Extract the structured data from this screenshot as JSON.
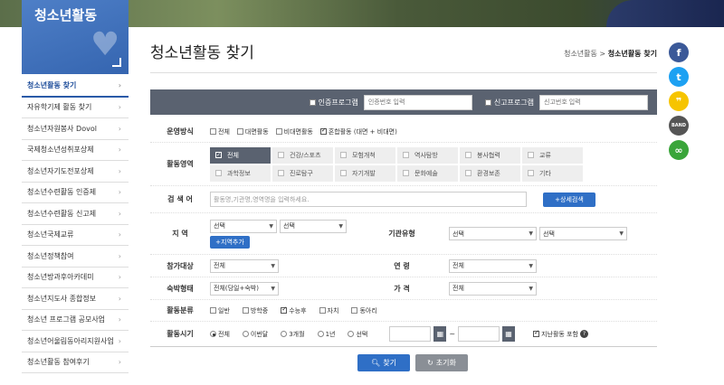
{
  "sidebar": {
    "title": "청소년활동",
    "items": [
      {
        "label": "청소년활동 찾기",
        "active": true
      },
      {
        "label": "자유학기제 활동 찾기"
      },
      {
        "label": "청소년자원봉사 Dovol"
      },
      {
        "label": "국제청소년성취포상제"
      },
      {
        "label": "청소년자기도전포상제"
      },
      {
        "label": "청소년수련활동 인증제"
      },
      {
        "label": "청소년수련활동 신고제"
      },
      {
        "label": "청소년국제교류"
      },
      {
        "label": "청소년정책참여"
      },
      {
        "label": "청소년방과후아카데미"
      },
      {
        "label": "청소년지도사 종합정보"
      },
      {
        "label": "청소년 프로그램 공모사업"
      },
      {
        "label": "청소년어울림동아리지원사업"
      },
      {
        "label": "청소년활동 참여후기"
      }
    ]
  },
  "page": {
    "title": "청소년활동 찾기",
    "breadcrumb_parent": "청소년활동",
    "breadcrumb_sep": " > ",
    "breadcrumb_current": "청소년활동 찾기"
  },
  "social": [
    {
      "icon": "facebook-icon",
      "glyph": "f",
      "color": "#3b5998"
    },
    {
      "icon": "twitter-icon",
      "glyph": "t",
      "color": "#1da1f2"
    },
    {
      "icon": "kakaostory-icon",
      "glyph": "❞",
      "color": "#f6c400"
    },
    {
      "icon": "band-icon",
      "glyph": "BAND",
      "color": "#555"
    },
    {
      "icon": "link-icon",
      "glyph": "∞",
      "color": "#3aa53a"
    }
  ],
  "topsearch": {
    "cert_label": "인증프로그램",
    "cert_placeholder": "인증번호 입력",
    "report_label": "신고프로그램",
    "report_placeholder": "신고번호 입력"
  },
  "form": {
    "operation": {
      "label": "운영방식",
      "options": [
        {
          "label": "전체",
          "checked": false
        },
        {
          "label": "대면활동",
          "checked": false
        },
        {
          "label": "비대면활동",
          "checked": false
        },
        {
          "label": "혼합활동 (대면 + 비대면)",
          "checked": true
        }
      ]
    },
    "area": {
      "label": "활동영역",
      "options": [
        "전체",
        "건강/스포츠",
        "모험개척",
        "역사탐방",
        "봉사협력",
        "교류",
        "과학정보",
        "진로탐구",
        "자기개발",
        "문화예술",
        "환경보존",
        "기타"
      ]
    },
    "keyword": {
      "label": "검 색 어",
      "placeholder": "활동명,기관명,영역명을 입력하세요.",
      "detail_button": "+상세검색"
    },
    "region": {
      "label": "지    역",
      "select1": "선택",
      "select2": "선택",
      "add_button": "+지역추가"
    },
    "org_type": {
      "label": "기관유형",
      "select1": "선택",
      "select2": "선택"
    },
    "target": {
      "label": "참가대상",
      "value": "전체"
    },
    "age": {
      "label": "연    령",
      "value": "전체"
    },
    "stay": {
      "label": "숙박형태",
      "value": "전체(당일+숙박)"
    },
    "price": {
      "label": "가    격",
      "value": "전체"
    },
    "category": {
      "label": "활동분류",
      "options": [
        {
          "label": "일반",
          "checked": false
        },
        {
          "label": "방학중",
          "checked": false
        },
        {
          "label": "수능후",
          "checked": true
        },
        {
          "label": "자치",
          "checked": false
        },
        {
          "label": "동아리",
          "checked": false
        }
      ]
    },
    "period": {
      "label": "활동시기",
      "options": [
        {
          "label": "전체",
          "checked": true
        },
        {
          "label": "이번달",
          "checked": false
        },
        {
          "label": "3개월",
          "checked": false
        },
        {
          "label": "1년",
          "checked": false
        },
        {
          "label": "선택",
          "checked": false
        }
      ],
      "range_sep": "~",
      "past_label": "지난활동 포함",
      "past_checked": true
    }
  },
  "actions": {
    "search": "찾기",
    "reset": "초기화"
  }
}
